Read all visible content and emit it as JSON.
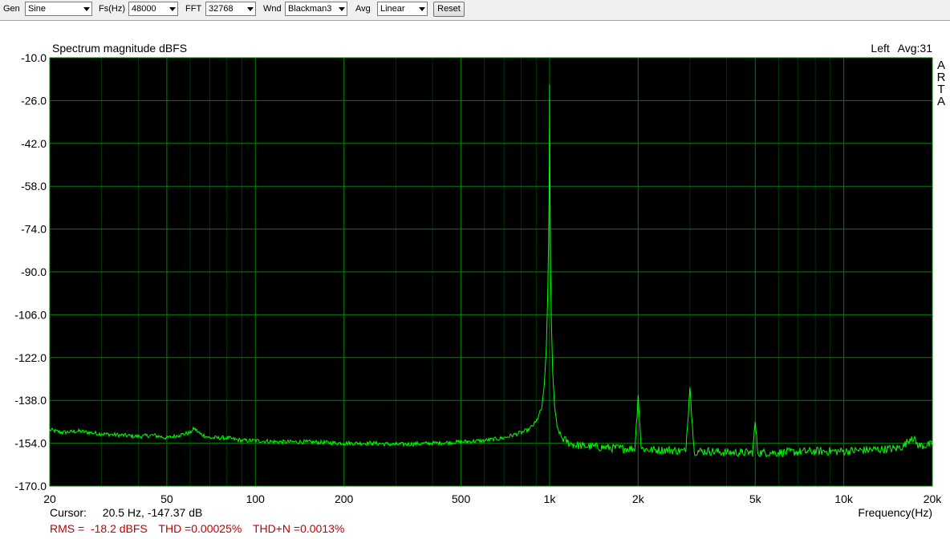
{
  "toolbar": {
    "gen_label": "Gen",
    "gen_value": "Sine",
    "fs_label": "Fs(Hz)",
    "fs_value": "48000",
    "fft_label": "FFT",
    "fft_value": "32768",
    "wnd_label": "Wnd",
    "wnd_value": "Blackman3",
    "avg_label": "Avg",
    "avg_value": "Linear",
    "reset_label": "Reset"
  },
  "plot": {
    "title": "Spectrum magnitude dBFS",
    "channel": "Left",
    "averages": "Avg:31",
    "brand_letters": [
      "A",
      "R",
      "T",
      "A"
    ]
  },
  "status": {
    "cursor_label": "Cursor:",
    "cursor_value": "20.5 Hz, -147.37 dB",
    "rms": "RMS =  -18.2 dBFS",
    "thd": "THD =0.00025%",
    "thdn": "THD+N =0.0013%",
    "frequency_label": "Frequency(Hz)"
  },
  "colors": {
    "background": "#000000",
    "grid": "#008000",
    "trace": "#00ff00",
    "measurement_text": "#c00000"
  },
  "chart_data": {
    "type": "line",
    "title": "Spectrum magnitude dBFS",
    "xlabel": "Frequency(Hz)",
    "ylabel": "",
    "xscale": "log",
    "xlim": [
      20,
      20000
    ],
    "ylim": [
      -170,
      -10
    ],
    "x_ticks": [
      20,
      50,
      100,
      200,
      500,
      1000,
      2000,
      5000,
      10000,
      20000
    ],
    "x_tick_labels": [
      "20",
      "50",
      "100",
      "200",
      "500",
      "1k",
      "2k",
      "5k",
      "10k",
      "20k"
    ],
    "y_ticks": [
      -10,
      -26,
      -42,
      -58,
      -74,
      -90,
      -106,
      -122,
      -138,
      -154,
      -170
    ],
    "y_tick_labels": [
      "-10.0",
      "-26.0",
      "-42.0",
      "-58.0",
      "-74.0",
      "-90.0",
      "-106.0",
      "-122.0",
      "-138.0",
      "-154.0",
      "-170.0"
    ],
    "grid": true,
    "series": [
      {
        "x": [
          20,
          22,
          25,
          30,
          35,
          40,
          45,
          50,
          55,
          60,
          62,
          65,
          70,
          80,
          90,
          100,
          120,
          150,
          200,
          250,
          300,
          400,
          500,
          600,
          700,
          800,
          850,
          900,
          940,
          960,
          975,
          985,
          992,
          996,
          998,
          1000,
          1002,
          1004,
          1008,
          1015,
          1025,
          1040,
          1060,
          1100,
          1150,
          1200,
          1300,
          1500,
          1800,
          1950,
          2000,
          2050,
          2200,
          2500,
          2900,
          3000,
          3100,
          3500,
          4000,
          4500,
          4900,
          5000,
          5100,
          6000,
          8000,
          10000,
          12000,
          15000,
          16000,
          17000,
          18000,
          20000
        ],
        "y": [
          -149,
          -150,
          -149.5,
          -150.5,
          -151,
          -151.5,
          -151,
          -152,
          -151,
          -150,
          -148.5,
          -150.5,
          -152,
          -152,
          -153,
          -153,
          -153.5,
          -153.5,
          -154,
          -154,
          -154.5,
          -154,
          -153.5,
          -153,
          -152,
          -150,
          -149,
          -146,
          -141,
          -132,
          -118,
          -100,
          -80,
          -62,
          -48,
          -20,
          -45,
          -65,
          -90,
          -110,
          -128,
          -140,
          -148,
          -152,
          -153.5,
          -154.5,
          -155,
          -155.5,
          -156,
          -156,
          -136,
          -156,
          -156.5,
          -156.5,
          -157,
          -133,
          -157,
          -157,
          -157.5,
          -157.5,
          -157.5,
          -146,
          -157.5,
          -157.5,
          -157,
          -157,
          -156.5,
          -156,
          -155,
          -151.5,
          -155,
          -154.5
        ]
      }
    ]
  }
}
